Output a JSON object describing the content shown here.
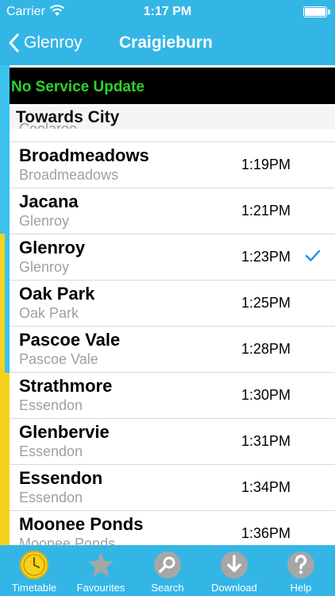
{
  "status": {
    "carrier": "Carrier",
    "time": "1:17 PM"
  },
  "nav": {
    "back_label": "Glenroy",
    "title": "Craigieburn"
  },
  "service_update": "No Service Update",
  "section": {
    "title": "Towards City",
    "peek_station": "Coolaroo"
  },
  "rows": [
    {
      "station": "Broadmeadows",
      "sub": "Broadmeadows",
      "time": "1:19PM",
      "selected": false
    },
    {
      "station": "Jacana",
      "sub": "Glenroy",
      "time": "1:21PM",
      "selected": false
    },
    {
      "station": "Glenroy",
      "sub": "Glenroy",
      "time": "1:23PM",
      "selected": true
    },
    {
      "station": "Oak Park",
      "sub": "Oak Park",
      "time": "1:25PM",
      "selected": false
    },
    {
      "station": "Pascoe Vale",
      "sub": "Pascoe Vale",
      "time": "1:28PM",
      "selected": false
    },
    {
      "station": "Strathmore",
      "sub": "Essendon",
      "time": "1:30PM",
      "selected": false
    },
    {
      "station": "Glenbervie",
      "sub": "Essendon",
      "time": "1:31PM",
      "selected": false
    },
    {
      "station": "Essendon",
      "sub": "Essendon",
      "time": "1:34PM",
      "selected": false
    },
    {
      "station": "Moonee Ponds",
      "sub": "Moonee Ponds",
      "time": "1:36PM",
      "selected": false
    }
  ],
  "tabs": [
    {
      "label": "Timetable",
      "icon": "clock-icon",
      "active": true
    },
    {
      "label": "Favourites",
      "icon": "star-icon",
      "active": false
    },
    {
      "label": "Search",
      "icon": "search-icon",
      "active": false
    },
    {
      "label": "Download",
      "icon": "download-icon",
      "active": false
    },
    {
      "label": "Help",
      "icon": "help-icon",
      "active": false
    }
  ],
  "colors": {
    "accent": "#33b6e6",
    "line_blue": "#3bc3ee",
    "line_yellow": "#f6d21c",
    "service_text": "#2ed12e",
    "check": "#1a8fe0"
  }
}
